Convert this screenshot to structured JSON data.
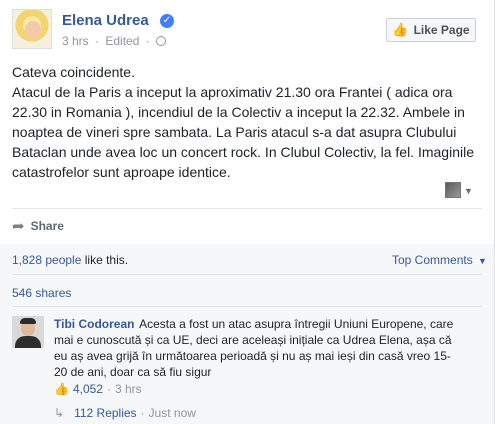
{
  "post": {
    "author": "Elena Udrea",
    "timestamp": "3 hrs",
    "edited": "Edited",
    "like_page_label": "Like Page",
    "paragraph_1": "Cateva coincidente.",
    "paragraph_2": "Atacul de la Paris a inceput la aproximativ 21.30 ora Frantei ( adica ora 22.30 in Romania ), incendiul de la Colectiv a inceput la 22.32. Ambele in noaptea de vineri spre sambata. La Paris atacul s-a dat asupra Clubului Bataclan unde avea loc un concert rock. In Clubul Colectiv, la fel. Imaginile catastrofelor sunt aproape identice.",
    "share_label": "Share"
  },
  "feedback": {
    "likes_count": "1,828 people",
    "likes_suffix": "like this.",
    "top_comments_label": "Top Comments",
    "shares_label": "546 shares"
  },
  "comment": {
    "author": "Tibi Codorean",
    "text": "Acesta a fost un atac asupra întregii Uniuni Europene, care mai e cunoscută și ca UE, deci are aceleași inițiale ca Udrea Elena, așa că eu aș avea grijă în următoarea perioadă și nu aș mai ieși din casă vreo 15-20 de ani, doar ca să fiu sigur",
    "like_count": "4,052",
    "separator": "·",
    "timestamp": "3 hrs",
    "replies_label": "112 Replies",
    "replies_time": "Just now"
  },
  "colors": {
    "link": "#365899",
    "verified": "#4080ff",
    "muted": "#90949c"
  },
  "icons": [
    "verified-badge-icon",
    "globe-icon",
    "thumbs-up-icon",
    "share-arrow-icon",
    "chevron-down-icon",
    "reply-arrow-icon"
  ]
}
